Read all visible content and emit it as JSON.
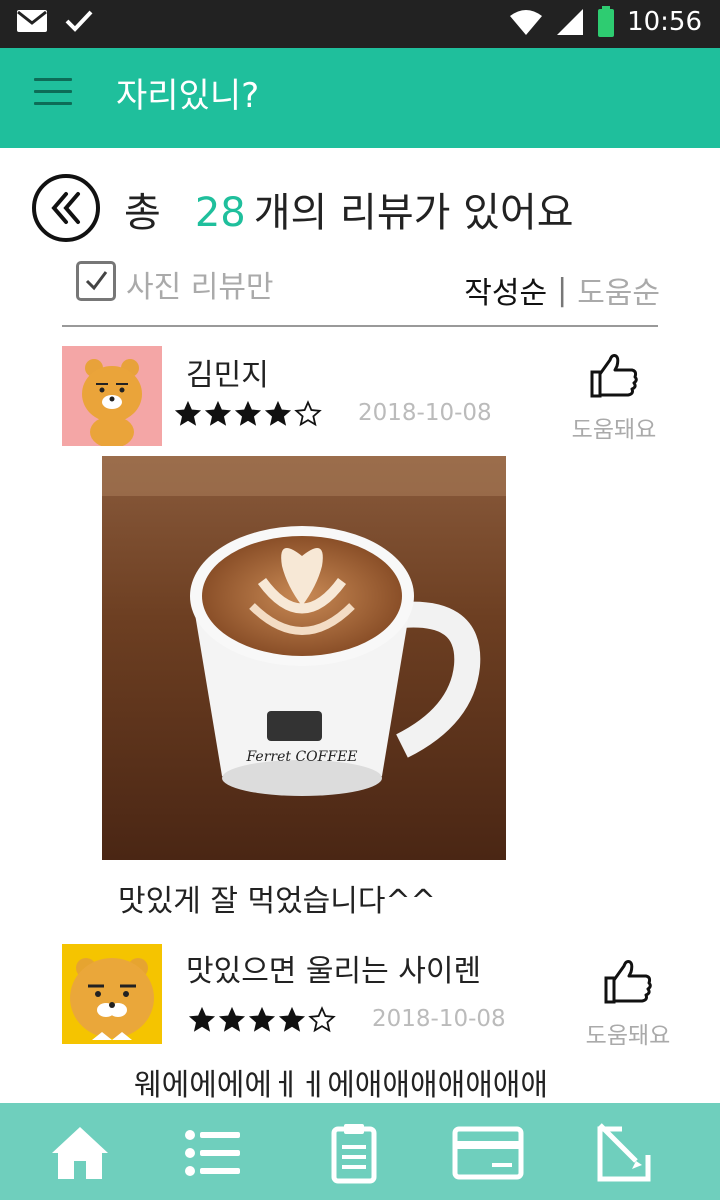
{
  "status_bar": {
    "time": "10:56"
  },
  "app_bar": {
    "title": "자리있니?"
  },
  "header": {
    "prefix": "총",
    "count": "28",
    "suffix": "개의 리뷰가 있어요"
  },
  "filter": {
    "photo_only_label": "사진 리뷰만",
    "photo_only_checked": true,
    "sort_options": [
      "작성순",
      "도움순"
    ],
    "sort_separator": "|",
    "selected_sort": "작성순"
  },
  "reviews": [
    {
      "name": "김민지",
      "rating": 4,
      "max_rating": 5,
      "date": "2018-10-08",
      "helpful_label": "도움돼요",
      "text": "맛있게 잘 먹었습니다^^",
      "photo_caption": "Ferret COFFEE",
      "avatar_bg": "#f4a6a6"
    },
    {
      "name": "맛있으면 울리는 사이렌",
      "rating": 4,
      "max_rating": 5,
      "date": "2018-10-08",
      "helpful_label": "도움돼요",
      "text": "웨에에에에ㅔㅔ에애애애애애애애",
      "avatar_bg": "#f5c400"
    }
  ],
  "bottom_nav": [
    "home-icon",
    "list-icon",
    "clipboard-icon",
    "card-icon",
    "edit-icon"
  ],
  "colors": {
    "accent": "#1fbf9c",
    "bottom_nav": "#6fcfbd",
    "status_bar": "#222222"
  }
}
